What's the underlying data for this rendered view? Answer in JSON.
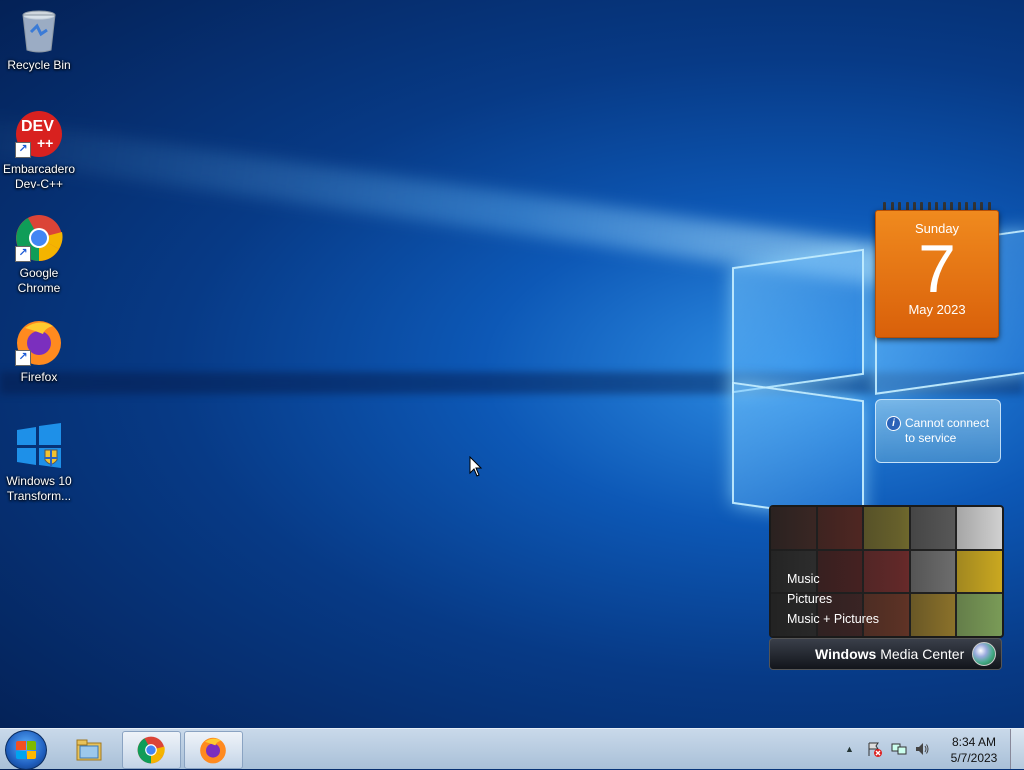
{
  "desktop": {
    "icons": [
      {
        "label": "Recycle Bin"
      },
      {
        "label": "Embarcadero Dev-C++",
        "logo_text": "DEV",
        "logo_sub": "++"
      },
      {
        "label": "Google Chrome"
      },
      {
        "label": "Firefox"
      },
      {
        "label": "Windows 10 Transform..."
      }
    ]
  },
  "gadgets": {
    "calendar": {
      "weekday": "Sunday",
      "day": "7",
      "month_year": "May 2023"
    },
    "weather": {
      "message": "Cannot connect to service",
      "info_glyph": "i"
    },
    "media_center": {
      "menu": [
        "Music",
        "Pictures",
        "Music + Pictures"
      ],
      "title_strong": "Windows",
      "title_rest": "Media Center"
    }
  },
  "taskbar": {
    "clock": {
      "time": "8:34 AM",
      "date": "5/7/2023"
    },
    "tray_expand_glyph": "▲"
  },
  "colors": {
    "calendar_orange": "#e8741a",
    "taskbar": "#b9cde1"
  }
}
